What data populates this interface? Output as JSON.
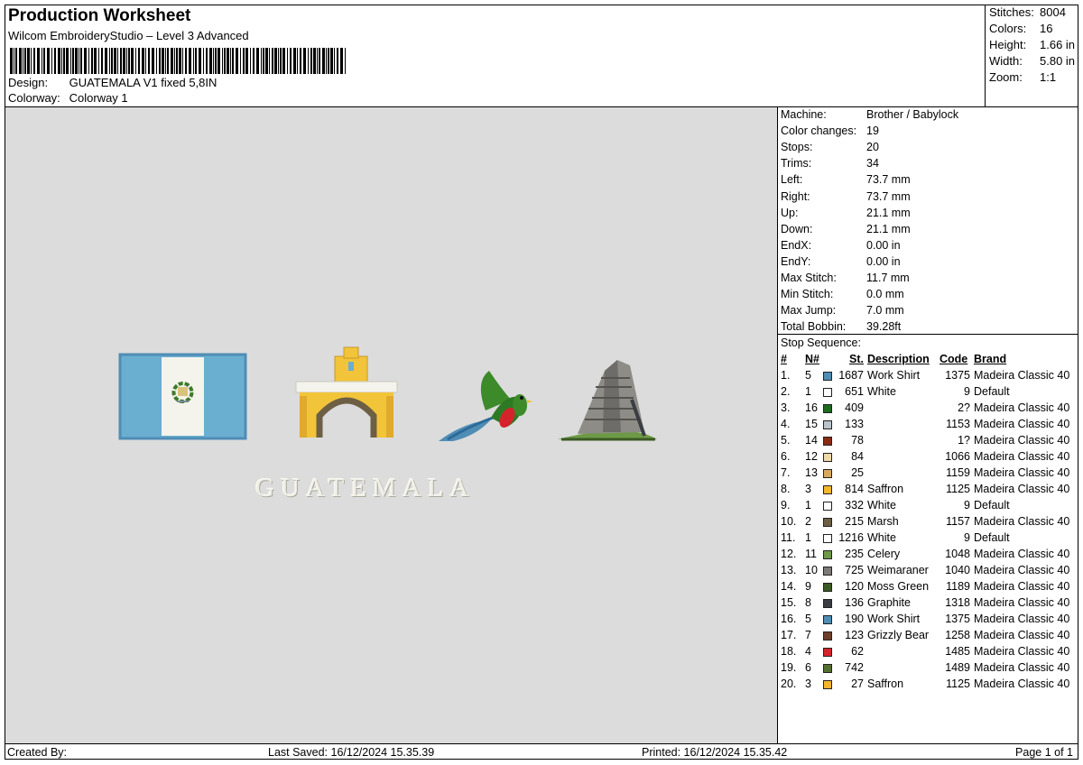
{
  "header": {
    "title": "Production Worksheet",
    "subtitle": "Wilcom EmbroideryStudio – Level 3 Advanced",
    "design_label": "Design:",
    "design_value": "GUATEMALA V1 fixed 5,8IN",
    "colorway_label": "Colorway:",
    "colorway_value": "Colorway 1"
  },
  "stats": [
    {
      "label": "Stitches:",
      "value": "8004"
    },
    {
      "label": "Colors:",
      "value": "16"
    },
    {
      "label": "Height:",
      "value": "1.66 in"
    },
    {
      "label": "Width:",
      "value": "5.80 in"
    },
    {
      "label": "Zoom:",
      "value": "1:1"
    }
  ],
  "machine_info": [
    {
      "label": "Machine:",
      "value": "Brother / Babylock"
    },
    {
      "label": "Color changes:",
      "value": "19"
    },
    {
      "label": "Stops:",
      "value": "20"
    },
    {
      "label": "Trims:",
      "value": "34"
    },
    {
      "label": "Left:",
      "value": "73.7 mm"
    },
    {
      "label": "Right:",
      "value": "73.7 mm"
    },
    {
      "label": "Up:",
      "value": "21.1 mm"
    },
    {
      "label": "Down:",
      "value": "21.1 mm"
    },
    {
      "label": "EndX:",
      "value": "0.00 in"
    },
    {
      "label": "EndY:",
      "value": "0.00 in"
    },
    {
      "label": "Max Stitch:",
      "value": "11.7 mm"
    },
    {
      "label": "Min Stitch:",
      "value": "0.0 mm"
    },
    {
      "label": "Max Jump:",
      "value": "7.0 mm"
    },
    {
      "label": "Total Bobbin:",
      "value": "39.28ft"
    }
  ],
  "stop_sequence": {
    "title": "Stop Sequence:",
    "columns": [
      "#",
      "N#",
      "St.",
      "Description",
      "Code",
      "Brand"
    ],
    "rows": [
      {
        "idx": "1.",
        "n": "5",
        "color": "#4f8db5",
        "st": "1687",
        "desc": "Work Shirt",
        "code": "1375",
        "brand": "Madeira Classic 40"
      },
      {
        "idx": "2.",
        "n": "1",
        "color": "#ffffff",
        "st": "651",
        "desc": "White",
        "code": "9",
        "brand": "Default"
      },
      {
        "idx": "3.",
        "n": "16",
        "color": "#1d6b1f",
        "st": "409",
        "desc": "",
        "code": "2?",
        "brand": "Madeira Classic 40"
      },
      {
        "idx": "4.",
        "n": "15",
        "color": "#b9c4cd",
        "st": "133",
        "desc": "",
        "code": "1153",
        "brand": "Madeira Classic 40"
      },
      {
        "idx": "5.",
        "n": "14",
        "color": "#8a2a12",
        "st": "78",
        "desc": "",
        "code": "1?",
        "brand": "Madeira Classic 40"
      },
      {
        "idx": "6.",
        "n": "12",
        "color": "#f0d8a8",
        "st": "84",
        "desc": "",
        "code": "1066",
        "brand": "Madeira Classic 40"
      },
      {
        "idx": "7.",
        "n": "13",
        "color": "#d9a85c",
        "st": "25",
        "desc": "",
        "code": "1159",
        "brand": "Madeira Classic 40"
      },
      {
        "idx": "8.",
        "n": "3",
        "color": "#f4b62a",
        "st": "814",
        "desc": "Saffron",
        "code": "1125",
        "brand": "Madeira Classic 40"
      },
      {
        "idx": "9.",
        "n": "1",
        "color": "#ffffff",
        "st": "332",
        "desc": "White",
        "code": "9",
        "brand": "Default"
      },
      {
        "idx": "10.",
        "n": "2",
        "color": "#6d5f44",
        "st": "215",
        "desc": "Marsh",
        "code": "1157",
        "brand": "Madeira Classic 40"
      },
      {
        "idx": "11.",
        "n": "1",
        "color": "#ffffff",
        "st": "1216",
        "desc": "White",
        "code": "9",
        "brand": "Default"
      },
      {
        "idx": "12.",
        "n": "11",
        "color": "#6d9a46",
        "st": "235",
        "desc": "Celery",
        "code": "1048",
        "brand": "Madeira Classic 40"
      },
      {
        "idx": "13.",
        "n": "10",
        "color": "#7c7a78",
        "st": "725",
        "desc": "Weimaraner",
        "code": "1040",
        "brand": "Madeira Classic 40"
      },
      {
        "idx": "14.",
        "n": "9",
        "color": "#3c5a24",
        "st": "120",
        "desc": "Moss Green",
        "code": "1189",
        "brand": "Madeira Classic 40"
      },
      {
        "idx": "15.",
        "n": "8",
        "color": "#3a3d44",
        "st": "136",
        "desc": "Graphite",
        "code": "1318",
        "brand": "Madeira Classic 40"
      },
      {
        "idx": "16.",
        "n": "5",
        "color": "#4f8db5",
        "st": "190",
        "desc": "Work Shirt",
        "code": "1375",
        "brand": "Madeira Classic 40"
      },
      {
        "idx": "17.",
        "n": "7",
        "color": "#6e3f2a",
        "st": "123",
        "desc": "Grizzly Bear",
        "code": "1258",
        "brand": "Madeira Classic 40"
      },
      {
        "idx": "18.",
        "n": "4",
        "color": "#d4232a",
        "st": "62",
        "desc": "",
        "code": "1485",
        "brand": "Madeira Classic 40"
      },
      {
        "idx": "19.",
        "n": "6",
        "color": "#54702e",
        "st": "742",
        "desc": "",
        "code": "1489",
        "brand": "Madeira Classic 40"
      },
      {
        "idx": "20.",
        "n": "3",
        "color": "#f4b62a",
        "st": "27",
        "desc": "Saffron",
        "code": "1125",
        "brand": "Madeira Classic 40"
      }
    ]
  },
  "preview": {
    "embroidered_text": "GUATEMALA",
    "background_color": "#dcdcdc",
    "motifs": [
      "flag-of-guatemala",
      "santa-catalina-arch",
      "quetzal-bird",
      "mayan-pyramid"
    ]
  },
  "footer": {
    "created_by": "Created By:",
    "last_saved": "Last Saved: 16/12/2024 15.35.39",
    "printed": "Printed: 16/12/2024 15.35.42",
    "page": "Page 1 of 1"
  }
}
